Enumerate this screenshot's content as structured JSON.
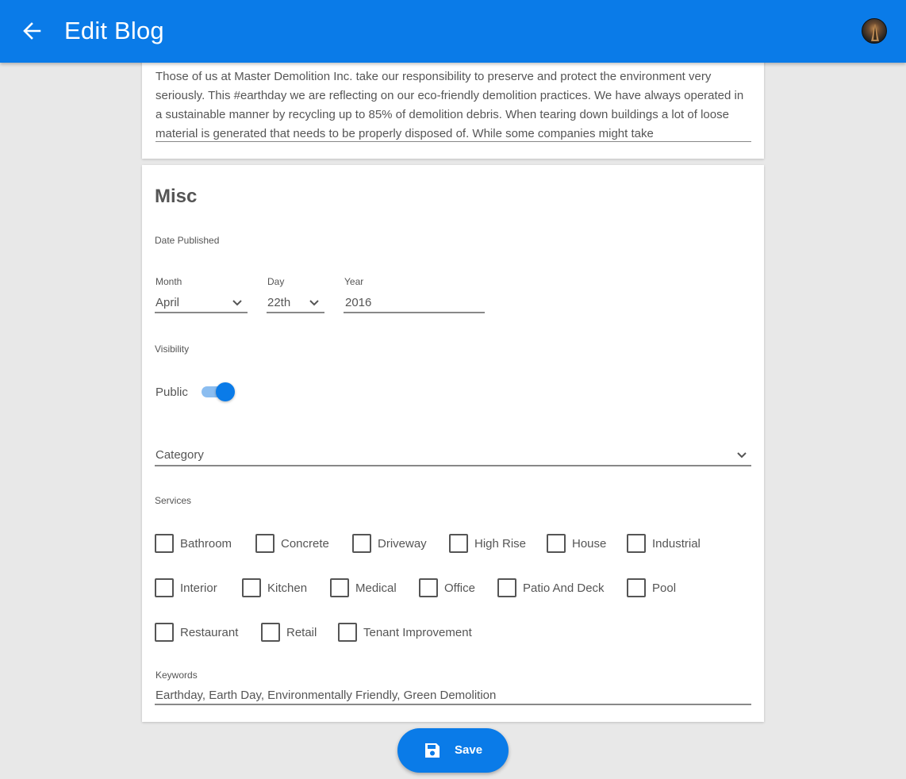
{
  "appbar": {
    "title": "Edit Blog",
    "back_icon": "arrow-left-icon",
    "avatar_icon": "user-avatar",
    "color": "#0a7be8"
  },
  "body": {
    "text": "Those of us at Master Demolition Inc. take our responsibility to preserve and protect the environment very seriously. This #earthday we are reflecting on our eco-friendly demolition practices. We have always operated in a sustainable manner by recycling up to 85% of demolition debris. When tearing down buildings a lot of loose material is generated that needs to be properly disposed of. While some companies might take"
  },
  "misc": {
    "title": "Misc",
    "date_published_label": "Date Published",
    "month": {
      "label": "Month",
      "value": "April"
    },
    "day": {
      "label": "Day",
      "value": "22th"
    },
    "year": {
      "label": "Year",
      "value": "2016"
    },
    "visibility_label": "Visibility",
    "visibility": {
      "label": "Public",
      "on": true
    },
    "category": {
      "placeholder": "Category"
    },
    "services_label": "Services",
    "services": [
      "Bathroom",
      "Concrete",
      "Driveway",
      "High Rise",
      "House",
      "Industrial",
      "Interior",
      "Kitchen",
      "Medical",
      "Office",
      "Patio And Deck",
      "Pool",
      "Restaurant",
      "Retail",
      "Tenant Improvement"
    ],
    "keywords": {
      "label": "Keywords",
      "value": "Earthday, Earth Day, Environmentally Friendly, Green Demolition"
    }
  },
  "save_button": {
    "label": "Save",
    "icon": "floppy-disk-icon"
  }
}
